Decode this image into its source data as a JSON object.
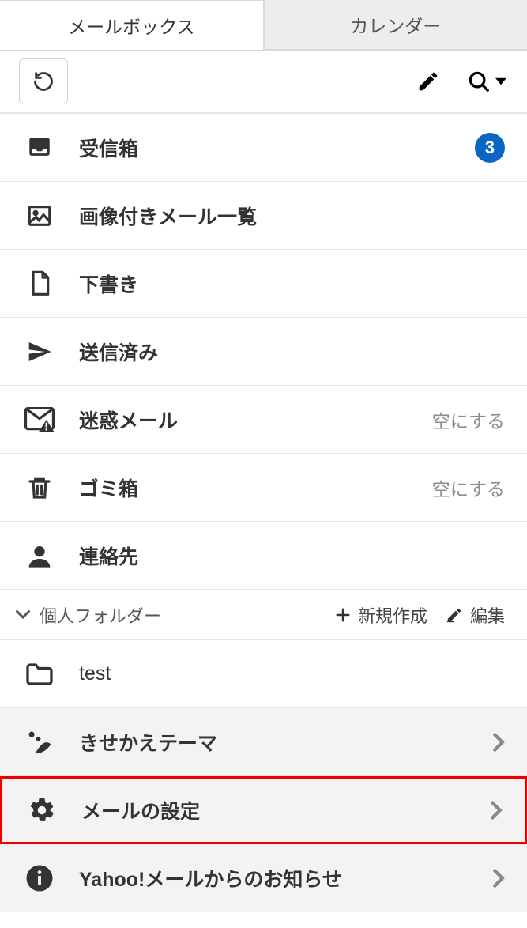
{
  "tabs": {
    "mail": "メールボックス",
    "calendar": "カレンダー"
  },
  "folders": {
    "inbox": {
      "label": "受信箱",
      "badge": "3"
    },
    "images": {
      "label": "画像付きメール一覧"
    },
    "drafts": {
      "label": "下書き"
    },
    "sent": {
      "label": "送信済み"
    },
    "spam": {
      "label": "迷惑メール",
      "action": "空にする"
    },
    "trash": {
      "label": "ゴミ箱",
      "action": "空にする"
    },
    "contacts": {
      "label": "連絡先"
    }
  },
  "personal": {
    "title": "個人フォルダー",
    "new": "新規作成",
    "edit": "編集",
    "items": [
      {
        "label": "test"
      }
    ]
  },
  "extras": {
    "theme": "きせかえテーマ",
    "settings": "メールの設定",
    "news": "Yahoo!メールからのお知らせ"
  }
}
